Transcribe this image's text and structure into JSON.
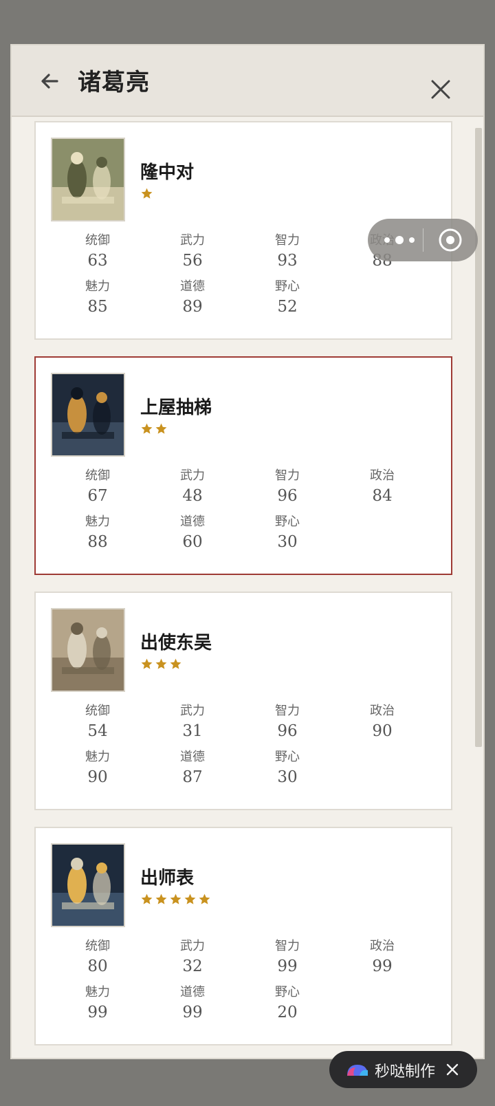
{
  "header": {
    "title": "诸葛亮"
  },
  "stat_labels": [
    "统御",
    "武力",
    "智力",
    "政治",
    "魅力",
    "道德",
    "野心"
  ],
  "cards": [
    {
      "name": "隆中对",
      "stars": 1,
      "selected": false,
      "stats": [
        "63",
        "56",
        "93",
        "88",
        "85",
        "89",
        "52"
      ]
    },
    {
      "name": "上屋抽梯",
      "stars": 2,
      "selected": true,
      "stats": [
        "67",
        "48",
        "96",
        "84",
        "88",
        "60",
        "30"
      ]
    },
    {
      "name": "出使东吴",
      "stars": 3,
      "selected": false,
      "stats": [
        "54",
        "31",
        "96",
        "90",
        "90",
        "87",
        "30"
      ]
    },
    {
      "name": "出师表",
      "stars": 5,
      "selected": false,
      "stats": [
        "80",
        "32",
        "99",
        "99",
        "99",
        "99",
        "20"
      ]
    }
  ],
  "badge": {
    "label": "秒哒制作"
  },
  "colors": {
    "star": "#c9921f",
    "selected_border": "#9e3a34",
    "card_bg": "#ffffff",
    "modal_bg": "#f3f0ea"
  },
  "icons": {
    "back": "arrow-left-icon",
    "close": "close-icon",
    "more": "more-dots-icon",
    "target": "target-icon",
    "star": "star-icon"
  }
}
